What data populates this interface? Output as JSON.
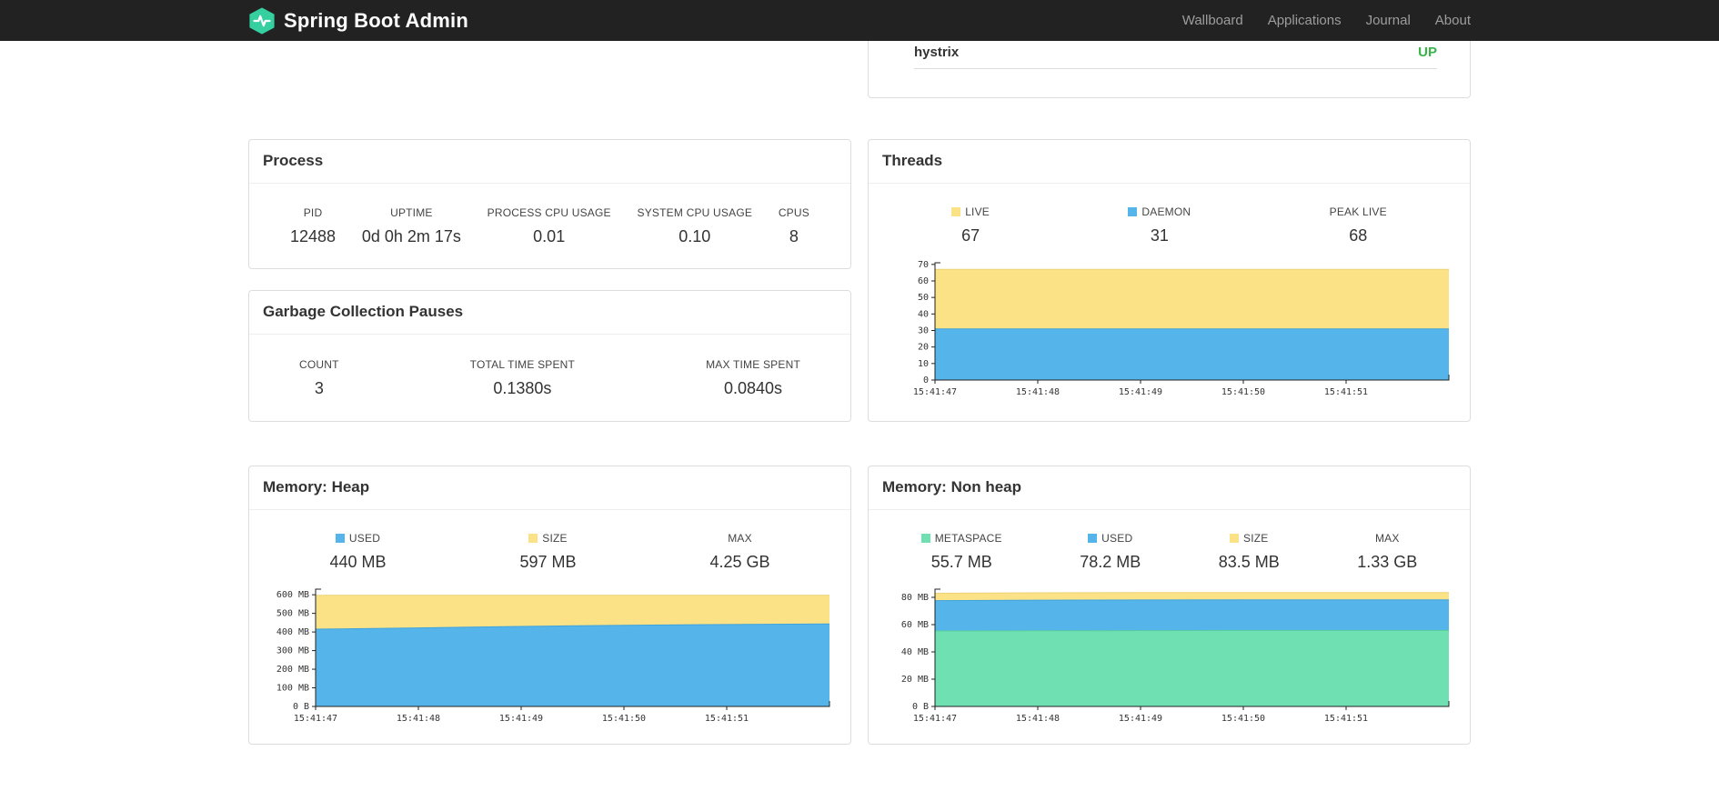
{
  "navbar": {
    "brand": "Spring Boot Admin",
    "links": [
      {
        "label": "Wallboard"
      },
      {
        "label": "Applications"
      },
      {
        "label": "Journal"
      },
      {
        "label": "About"
      }
    ]
  },
  "colors": {
    "navbar_bg": "#222222",
    "brand_green": "#36D0A0",
    "status_up_green": "#38b44a",
    "chart_yellow": "#FBE287",
    "chart_blue": "#55B5EB",
    "chart_green": "#6FE0B2"
  },
  "health_panel": {
    "application": "hystrix",
    "status": "UP"
  },
  "process_panel": {
    "title": "Process",
    "metrics": [
      {
        "label": "PID",
        "value": "12488"
      },
      {
        "label": "UPTIME",
        "value": "0d 0h 2m 17s"
      },
      {
        "label": "PROCESS CPU USAGE",
        "value": "0.01"
      },
      {
        "label": "SYSTEM CPU USAGE",
        "value": "0.10"
      },
      {
        "label": "CPUS",
        "value": "8"
      }
    ]
  },
  "gc_panel": {
    "title": "Garbage Collection Pauses",
    "metrics": [
      {
        "label": "COUNT",
        "value": "3"
      },
      {
        "label": "TOTAL TIME SPENT",
        "value": "0.1380s"
      },
      {
        "label": "MAX TIME SPENT",
        "value": "0.0840s"
      }
    ]
  },
  "threads_panel": {
    "title": "Threads",
    "legend": [
      {
        "label": "LIVE",
        "value": "67",
        "color": "#FBE287"
      },
      {
        "label": "DAEMON",
        "value": "31",
        "color": "#55B5EB"
      },
      {
        "label": "PEAK LIVE",
        "value": "68"
      }
    ]
  },
  "heap_panel": {
    "title": "Memory: Heap",
    "legend": [
      {
        "label": "USED",
        "value": "440 MB",
        "color": "#55B5EB"
      },
      {
        "label": "SIZE",
        "value": "597 MB",
        "color": "#FBE287"
      },
      {
        "label": "MAX",
        "value": "4.25 GB"
      }
    ]
  },
  "nonheap_panel": {
    "title": "Memory: Non heap",
    "legend": [
      {
        "label": "METASPACE",
        "value": "55.7 MB",
        "color": "#6FE0B2"
      },
      {
        "label": "USED",
        "value": "78.2 MB",
        "color": "#55B5EB"
      },
      {
        "label": "SIZE",
        "value": "83.5 MB",
        "color": "#FBE287"
      },
      {
        "label": "MAX",
        "value": "1.33 GB"
      }
    ]
  },
  "chart_data": [
    {
      "id": "threads",
      "type": "area",
      "title": "Threads",
      "x_labels": [
        "15:41:47",
        "15:41:48",
        "15:41:49",
        "15:41:50",
        "15:41:51"
      ],
      "ymax": 71,
      "y_ticks": [
        {
          "v": 0,
          "label": "0"
        },
        {
          "v": 10,
          "label": "10"
        },
        {
          "v": 20,
          "label": "20"
        },
        {
          "v": 30,
          "label": "30"
        },
        {
          "v": 40,
          "label": "40"
        },
        {
          "v": 50,
          "label": "50"
        },
        {
          "v": 60,
          "label": "60"
        },
        {
          "v": 70,
          "label": "70"
        }
      ],
      "series": [
        {
          "name": "LIVE",
          "color": "#FBE287",
          "line": "#EDD173",
          "values": [
            67,
            67,
            67,
            67,
            67,
            67
          ]
        },
        {
          "name": "DAEMON",
          "color": "#55B5EB",
          "line": "#3FA3DC",
          "values": [
            31,
            31,
            31,
            31,
            31,
            31
          ]
        }
      ]
    },
    {
      "id": "heap",
      "type": "area",
      "title": "Memory: Heap (MB)",
      "x_labels": [
        "15:41:47",
        "15:41:48",
        "15:41:49",
        "15:41:50",
        "15:41:51"
      ],
      "ymax": 630,
      "y_ticks": [
        {
          "v": 0,
          "label": "0 B"
        },
        {
          "v": 100,
          "label": "100 MB"
        },
        {
          "v": 200,
          "label": "200 MB"
        },
        {
          "v": 300,
          "label": "300 MB"
        },
        {
          "v": 400,
          "label": "400 MB"
        },
        {
          "v": 500,
          "label": "500 MB"
        },
        {
          "v": 600,
          "label": "600 MB"
        }
      ],
      "series": [
        {
          "name": "SIZE",
          "color": "#FBE287",
          "line": "#EDD173",
          "values": [
            597,
            597,
            597,
            597,
            597,
            597
          ]
        },
        {
          "name": "USED",
          "color": "#55B5EB",
          "line": "#3FA3DC",
          "values": [
            415,
            422,
            430,
            436,
            440,
            443
          ]
        }
      ]
    },
    {
      "id": "nonheap",
      "type": "area",
      "title": "Memory: Non heap (MB)",
      "x_labels": [
        "15:41:47",
        "15:41:48",
        "15:41:49",
        "15:41:50",
        "15:41:51"
      ],
      "ymax": 86,
      "y_ticks": [
        {
          "v": 0,
          "label": "0 B"
        },
        {
          "v": 20,
          "label": "20 MB"
        },
        {
          "v": 40,
          "label": "40 MB"
        },
        {
          "v": 60,
          "label": "60 MB"
        },
        {
          "v": 80,
          "label": "80 MB"
        }
      ],
      "series": [
        {
          "name": "SIZE",
          "color": "#FBE287",
          "line": "#EDD173",
          "values": [
            83.0,
            83.3,
            83.5,
            83.5,
            83.5,
            83.5
          ]
        },
        {
          "name": "USED",
          "color": "#55B5EB",
          "line": "#3FA3DC",
          "values": [
            77.6,
            77.9,
            78.1,
            78.2,
            78.2,
            78.2
          ]
        },
        {
          "name": "METASPACE",
          "color": "#6FE0B2",
          "line": "#57CE9E",
          "values": [
            55.3,
            55.5,
            55.6,
            55.7,
            55.7,
            55.7
          ]
        }
      ]
    }
  ]
}
